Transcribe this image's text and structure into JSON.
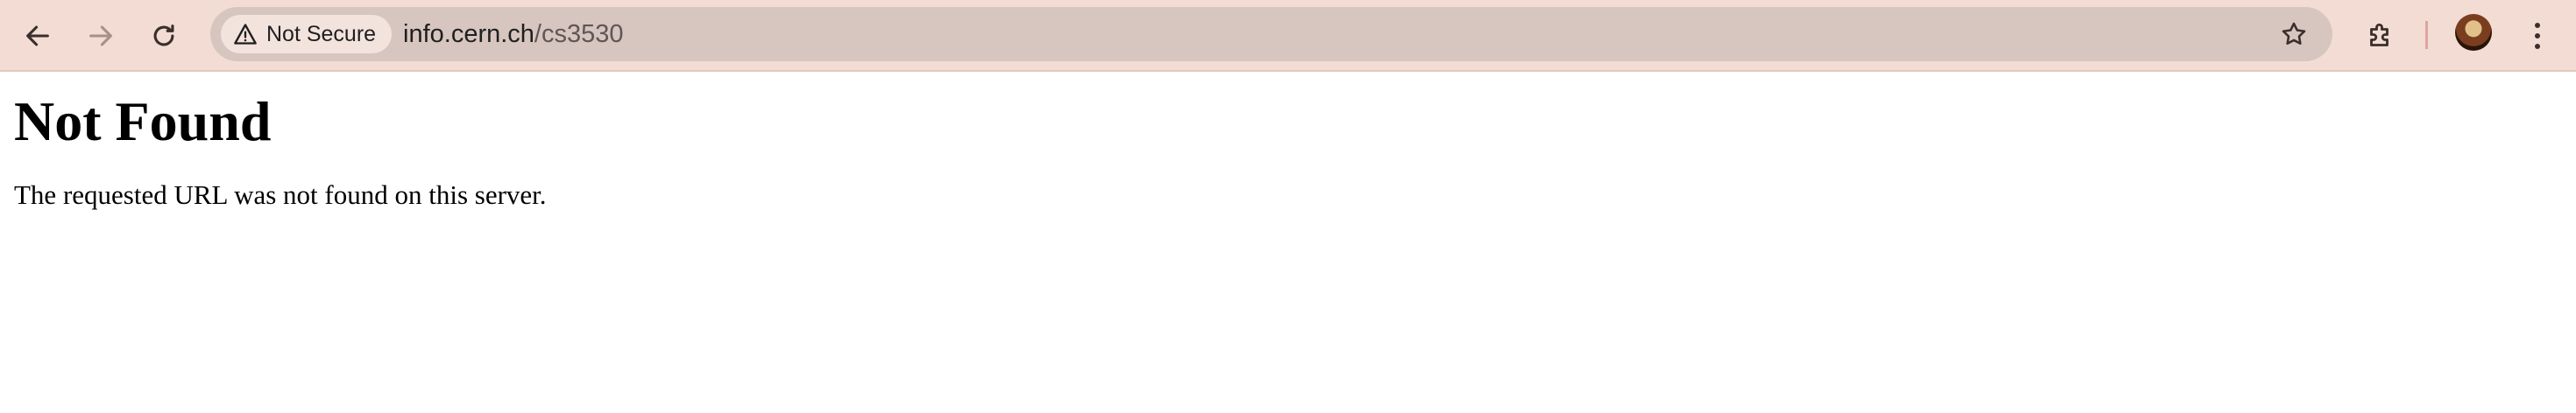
{
  "browser": {
    "toolbar": {
      "back_icon": "arrow-left-icon",
      "forward_icon": "arrow-right-icon",
      "reload_icon": "reload-icon",
      "extensions_icon": "puzzle-icon",
      "bookmark_icon": "star-icon",
      "menu_icon": "kebab-menu-icon"
    },
    "omnibox": {
      "security_label": "Not Secure",
      "security_icon": "warning-triangle-icon",
      "url_host": "info.cern.ch",
      "url_path": "/cs3530"
    },
    "colors": {
      "toolbar_bg": "#f2dcd4",
      "omnibox_bg": "#d7c5bf",
      "chip_bg": "#f3e3dd"
    }
  },
  "page": {
    "heading": "Not Found",
    "message": "The requested URL was not found on this server."
  }
}
